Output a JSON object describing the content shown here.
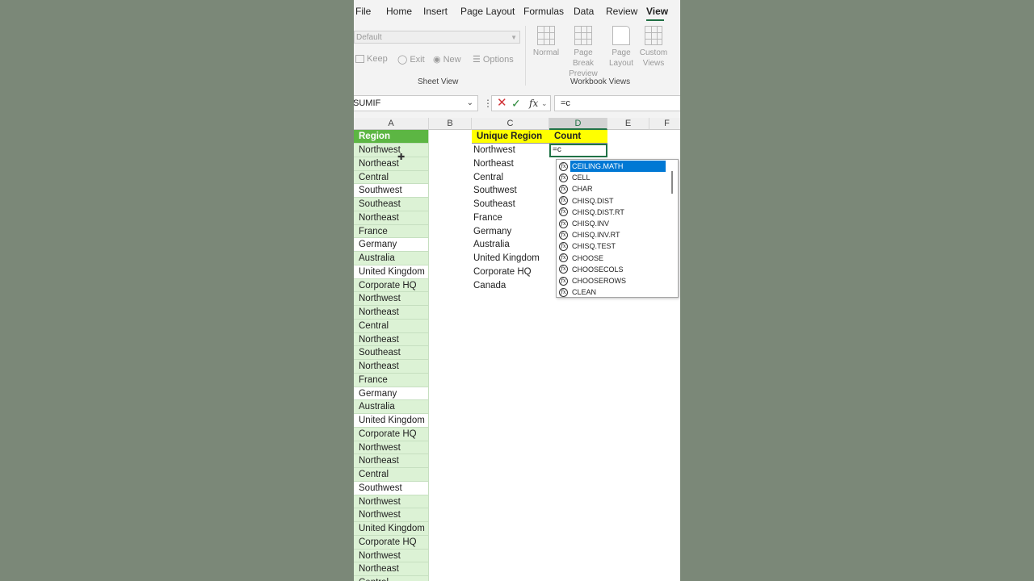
{
  "ribbon": {
    "tabs": [
      "File",
      "Home",
      "Insert",
      "Page Layout",
      "Formulas",
      "Data",
      "Review",
      "View"
    ],
    "active_tab": "View",
    "sheet_view": {
      "select_value": "Default",
      "keep_label": "Keep",
      "exit_label": "Exit",
      "new_label": "New",
      "options_label": "Options",
      "group_label": "Sheet View"
    },
    "workbook_views": {
      "normal_label": "Normal",
      "page_break_label": "Page Break Preview",
      "page_layout_label": "Page Layout",
      "custom_views_label": "Custom Views",
      "group_label": "Workbook Views"
    }
  },
  "formula_bar": {
    "name_box": "SUMIF",
    "formula": "=c",
    "fx": "fx"
  },
  "columns": [
    "A",
    "B",
    "C",
    "D",
    "E",
    "F"
  ],
  "selected_column": "D",
  "column_a": {
    "header": "Region",
    "values": [
      "Northwest",
      "Northeast",
      "Central",
      "Southwest",
      "Southeast",
      "Northeast",
      "France",
      "Germany",
      "Australia",
      "United Kingdom",
      "Corporate HQ",
      "Northwest",
      "Northeast",
      "Central",
      "Northeast",
      "Southeast",
      "Northeast",
      "France",
      "Germany",
      "Australia",
      "United Kingdom",
      "Corporate HQ",
      "Northwest",
      "Northeast",
      "Central",
      "Southwest",
      "Northwest",
      "Northwest",
      "United Kingdom",
      "Corporate HQ",
      "Northwest",
      "Northeast",
      "Central"
    ]
  },
  "column_c": {
    "header": "Unique Region",
    "values": [
      "Northwest",
      "Northeast",
      "Central",
      "Southwest",
      "Southeast",
      "France",
      "Germany",
      "Australia",
      "United Kingdom",
      "Corporate HQ",
      "Canada"
    ]
  },
  "column_d": {
    "header": "Count",
    "active_value": "=c"
  },
  "autocomplete": {
    "selected": "CEILING.MATH",
    "items": [
      "CEILING.MATH",
      "CELL",
      "CHAR",
      "CHISQ.DIST",
      "CHISQ.DIST.RT",
      "CHISQ.INV",
      "CHISQ.INV.RT",
      "CHISQ.TEST",
      "CHOOSE",
      "CHOOSECOLS",
      "CHOOSEROWS",
      "CLEAN"
    ],
    "icon_glyph": "fx"
  },
  "colors": {
    "region_header_green": "#5cb643",
    "region_fill_green": "#dcf2d5",
    "header_yellow": "#ffff00",
    "excel_green": "#217346",
    "selection_blue": "#0078d4"
  }
}
